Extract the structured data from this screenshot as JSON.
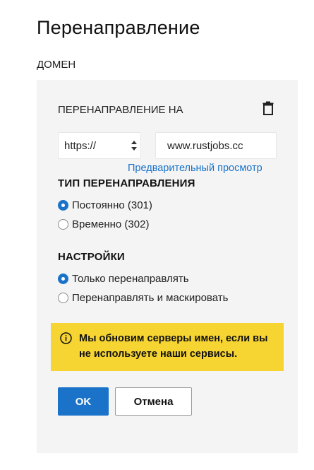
{
  "page": {
    "title": "Перенаправление",
    "domain_label": "ДОМЕН"
  },
  "redirect": {
    "label": "ПЕРЕНАПРАВЛЕНИЕ НА",
    "protocol": "https://",
    "domain_value": "www.rustjobs.cc",
    "preview_link": "Предварительный просмотр",
    "delete_icon": "trash-icon"
  },
  "redirect_type": {
    "title": "ТИП ПЕРЕНАПРАВЛЕНИЯ",
    "options": [
      {
        "label": "Постоянно (301)",
        "checked": true
      },
      {
        "label": "Временно (302)",
        "checked": false
      }
    ]
  },
  "settings": {
    "title": "НАСТРОЙКИ",
    "options": [
      {
        "label": "Только перенаправлять",
        "checked": true
      },
      {
        "label": "Перенаправлять и маскировать",
        "checked": false
      }
    ]
  },
  "notice": {
    "icon": "info-icon",
    "text": "Мы обновим серверы имен, если вы не используете наши сервисы."
  },
  "buttons": {
    "ok": "OK",
    "cancel": "Отмена"
  },
  "colors": {
    "accent": "#1a73c9",
    "panel_bg": "#f4f4f5",
    "notice_bg": "#f6d533"
  }
}
